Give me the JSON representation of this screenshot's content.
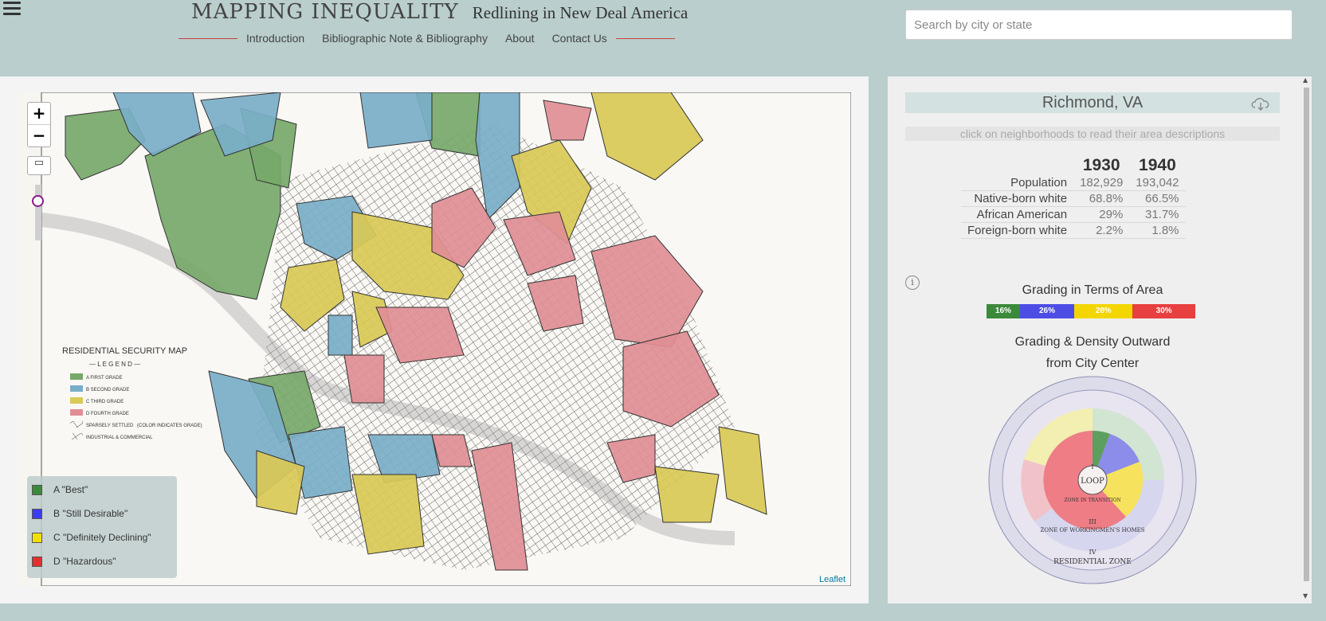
{
  "header": {
    "title": "MAPPING INEQUALITY",
    "subtitle": "Redlining in New Deal America",
    "nav": [
      "Introduction",
      "Bibliographic Note & Bibliography",
      "About",
      "Contact Us"
    ]
  },
  "search": {
    "placeholder": "Search by city or state"
  },
  "map": {
    "zoom_in": "+",
    "zoom_out": "−",
    "attribution": "Leaflet",
    "scan_title": "RESIDENTIAL SECURITY MAP",
    "scan_legend_heading": "— L E G E N D —",
    "scan_legend_items": [
      "A FIRST GRADE",
      "B SECOND GRADE",
      "C THIRD GRADE",
      "D FOURTH GRADE",
      "SPARSELY SETTLED",
      "INDUSTRIAL & COMMERCIAL"
    ],
    "scan_color_note": "(COLOR INDICATES GRADE)",
    "legend": [
      {
        "label": "A \"Best\"",
        "color": "#3b8a3b"
      },
      {
        "label": "B \"Still Desirable\"",
        "color": "#3b3bef"
      },
      {
        "label": "C \"Definitely Declining\"",
        "color": "#f0e000"
      },
      {
        "label": "D \"Hazardous\"",
        "color": "#e03030"
      }
    ],
    "grade_colors": {
      "A": "#76a869",
      "B": "#79aec8",
      "C": "#d9c956",
      "D": "#e08e94"
    }
  },
  "panel": {
    "city": "Richmond, VA",
    "hint": "click on neighborhoods to read their area descriptions",
    "table": {
      "years": [
        "1930",
        "1940"
      ],
      "rows": [
        {
          "label": "Population",
          "v1930": "182,929",
          "v1940": "193,042"
        },
        {
          "label": "Native-born white",
          "v1930": "68.8%",
          "v1940": "66.5%"
        },
        {
          "label": "African American",
          "v1930": "29%",
          "v1940": "31.7%"
        },
        {
          "label": "Foreign-born white",
          "v1930": "2.2%",
          "v1940": "1.8%"
        }
      ]
    },
    "grading_title": "Grading in Terms of Area",
    "grading": [
      {
        "grade": "A",
        "percent": "16%",
        "value": 16,
        "color": "#3b8a3b"
      },
      {
        "grade": "B",
        "percent": "26%",
        "value": 26,
        "color": "#4d4de6"
      },
      {
        "grade": "C",
        "percent": "28%",
        "value": 28,
        "color": "#f3d600"
      },
      {
        "grade": "D",
        "percent": "30%",
        "value": 30,
        "color": "#e84040"
      }
    ],
    "density_title_1": "Grading & Density Outward",
    "density_title_2": "from City Center",
    "density_labels": [
      "I",
      "LOOP",
      "ZONE IN TRANSITION",
      "III",
      "ZONE OF WORKINGMEN'S HOMES",
      "IV",
      "RESIDENTIAL ZONE"
    ]
  }
}
